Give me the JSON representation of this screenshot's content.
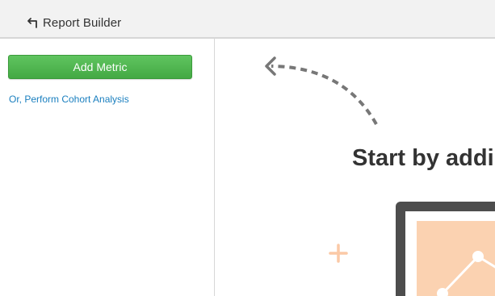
{
  "header": {
    "back_icon": "back-arrow-icon",
    "title": "Report Builder"
  },
  "sidebar": {
    "add_metric_label": "Add Metric",
    "cohort_link_label": "Or, Perform Cohort Analysis",
    "button_color": "#4cb34c",
    "link_color": "#1a7fbf"
  },
  "main": {
    "heading": "Start by addi",
    "arrow_icon": "dashed-curved-arrow-icon",
    "plus_icon": "plus-icon",
    "illustration": "chart-monitor-illustration",
    "accent_color": "#fbd2b1"
  }
}
